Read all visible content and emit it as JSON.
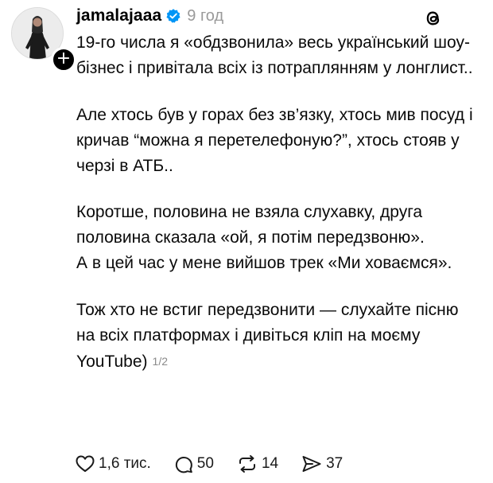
{
  "post": {
    "username": "jamalajaaa",
    "time": "9 год",
    "follow_symbol": "+",
    "paragraphs": [
      "19-го числа я «обдзвонила» весь український шоу-бізнес і привітала всіх із потраплянням у лонглист..",
      "Але хтось був у горах без зв’язку, хтось мив посуд і кричав “можна я перетелефоную?”, хтось стояв у черзі в АТБ..",
      "Коротше, половина не взяла слухавку, друга половина сказала «ой, я потім передзвоню».",
      "А в цей час у мене вийшов трек «Ми ховаємся».",
      "Тож хто не встиг передзвонити — слухайте пісню на всіх платформах і дивіться кліп на моєму YouTube)"
    ],
    "page_indicator": "1/2"
  },
  "actions": {
    "likes": "1,6 тис.",
    "replies": "50",
    "reposts": "14",
    "shares": "37"
  },
  "icons": {
    "verified": "verified-badge-icon",
    "threads": "threads-logo-icon",
    "like": "heart-icon",
    "reply": "comment-icon",
    "repost": "repost-icon",
    "share": "share-icon"
  },
  "colors": {
    "verified_blue": "#0095f6",
    "muted_text": "#9a9a9a",
    "text": "#0a0a0a"
  }
}
